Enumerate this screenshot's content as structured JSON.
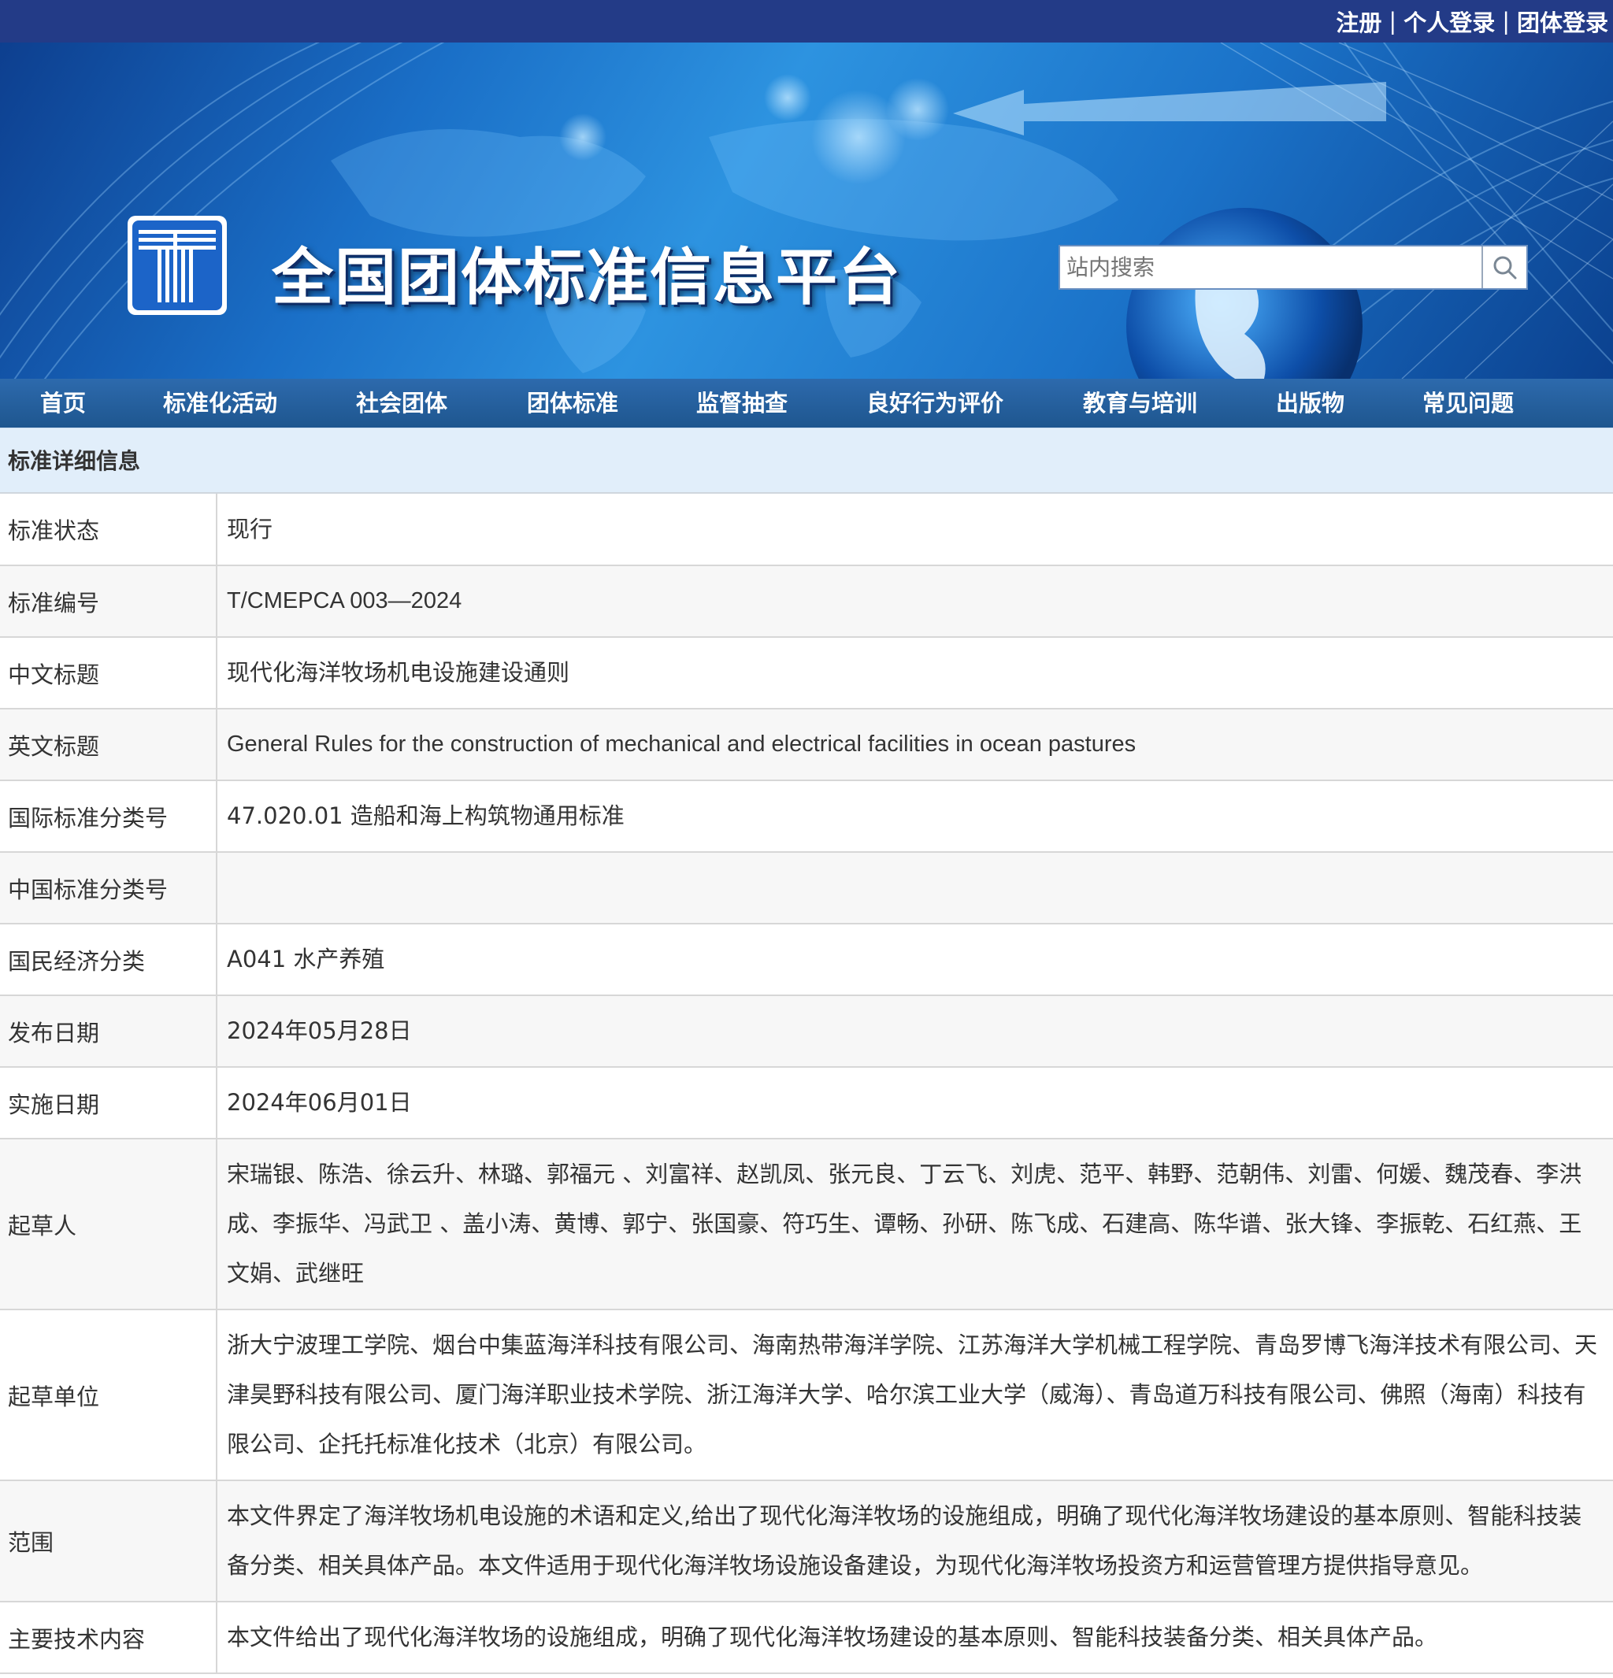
{
  "header": {
    "links": [
      "注册",
      "个人登录",
      "团体登录"
    ],
    "separator": "|"
  },
  "banner": {
    "site_title": "全国团体标准信息平台",
    "search_placeholder": "站内搜索"
  },
  "nav": {
    "items": [
      "首页",
      "标准化活动",
      "社会团体",
      "团体标准",
      "监督抽查",
      "良好行为评价",
      "教育与培训",
      "出版物",
      "常见问题"
    ]
  },
  "detail": {
    "heading": "标准详细信息",
    "rows": [
      {
        "label": "标准状态",
        "value": "现行"
      },
      {
        "label": "标准编号",
        "value": "T/CMEPCA 003—2024"
      },
      {
        "label": "中文标题",
        "value": "现代化海洋牧场机电设施建设通则"
      },
      {
        "label": "英文标题",
        "value": "General Rules for the construction of mechanical and electrical facilities in ocean pastures"
      },
      {
        "label": "国际标准分类号",
        "value": "47.020.01 造船和海上构筑物通用标准"
      },
      {
        "label": "中国标准分类号",
        "value": ""
      },
      {
        "label": "国民经济分类",
        "value": "A041 水产养殖"
      },
      {
        "label": "发布日期",
        "value": "2024年05月28日"
      },
      {
        "label": "实施日期",
        "value": "2024年06月01日"
      },
      {
        "label": "起草人",
        "value": "宋瑞银、陈浩、徐云升、林璐、郭福元 、刘富祥、赵凯凤、张元良、丁云飞、刘虎、范平、韩野、范朝伟、刘雷、何媛、魏茂春、李洪成、李振华、冯武卫 、盖小涛、黄博、郭宁、张国豪、符巧生、谭畅、孙研、陈飞成、石建高、陈华谱、张大锋、李振乾、石红燕、王文娟、武继旺"
      },
      {
        "label": "起草单位",
        "value": "浙大宁波理工学院、烟台中集蓝海洋科技有限公司、海南热带海洋学院、江苏海洋大学机械工程学院、青岛罗博飞海洋技术有限公司、天津昊野科技有限公司、厦门海洋职业技术学院、浙江海洋大学、哈尔滨工业大学（威海）、青岛道万科技有限公司、佛照（海南）科技有限公司、企托托标准化技术（北京）有限公司。"
      },
      {
        "label": "范围",
        "value": "本文件界定了海洋牧场机电设施的术语和定义,给出了现代化海洋牧场的设施组成，明确了现代化海洋牧场建设的基本原则、智能科技装备分类、相关具体产品。本文件适用于现代化海洋牧场设施设备建设，为现代化海洋牧场投资方和运营管理方提供指导意见。"
      },
      {
        "label": "主要技术内容",
        "value": "本文件给出了现代化海洋牧场的设施组成，明确了现代化海洋牧场建设的基本原则、智能科技装备分类、相关具体产品。"
      }
    ]
  }
}
